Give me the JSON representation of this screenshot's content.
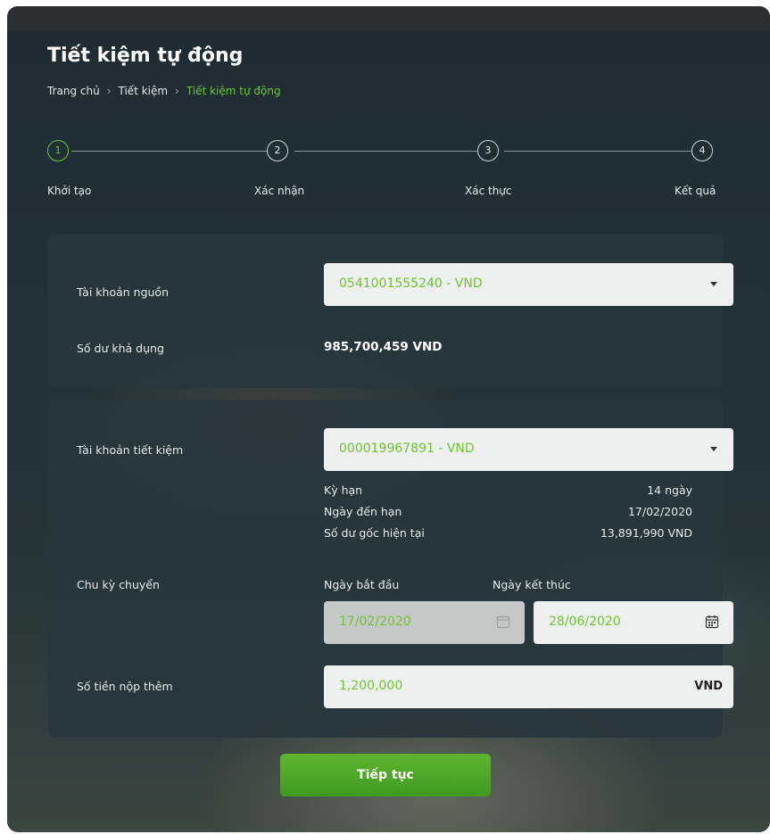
{
  "page": {
    "title": "Tiết kiệm tự động"
  },
  "breadcrumb": {
    "items": [
      "Trang chủ",
      "Tiết kiệm",
      "Tiết kiệm tự động"
    ],
    "separator": "›"
  },
  "stepper": {
    "steps": [
      {
        "number": "1",
        "label": "Khởi tạo",
        "active": true
      },
      {
        "number": "2",
        "label": "Xác nhận",
        "active": false
      },
      {
        "number": "3",
        "label": "Xác thực",
        "active": false
      },
      {
        "number": "4",
        "label": "Kết quả",
        "active": false
      }
    ]
  },
  "source": {
    "account_label": "Tài khoản nguồn",
    "account_value": "0541001555240 - VND",
    "balance_label": "Số dư khả dụng",
    "balance_value": "985,700,459 VND"
  },
  "savings": {
    "account_label": "Tài khoản tiết kiệm",
    "account_value": "000019967891 - VND",
    "details": [
      {
        "label": "Kỳ hạn",
        "value": "14 ngày"
      },
      {
        "label": "Ngày đến hạn",
        "value": "17/02/2020"
      },
      {
        "label": "Số dư gốc hiện tại",
        "value": "13,891,990 VND"
      }
    ],
    "cycle_label": "Chu kỳ chuyển",
    "start_label": "Ngày bắt đầu",
    "start_value": "17/02/2020",
    "end_label": "Ngày kết thúc",
    "end_value": "28/06/2020",
    "amount_label": "Số tiền nộp thêm",
    "amount_value": "1,200,000",
    "amount_currency": "VND"
  },
  "actions": {
    "continue_label": "Tiếp tục"
  },
  "colors": {
    "accent": "#6cc52e",
    "panel": "#28363d",
    "field": "#eef0ef",
    "disabled_field": "#c5c8c7"
  }
}
